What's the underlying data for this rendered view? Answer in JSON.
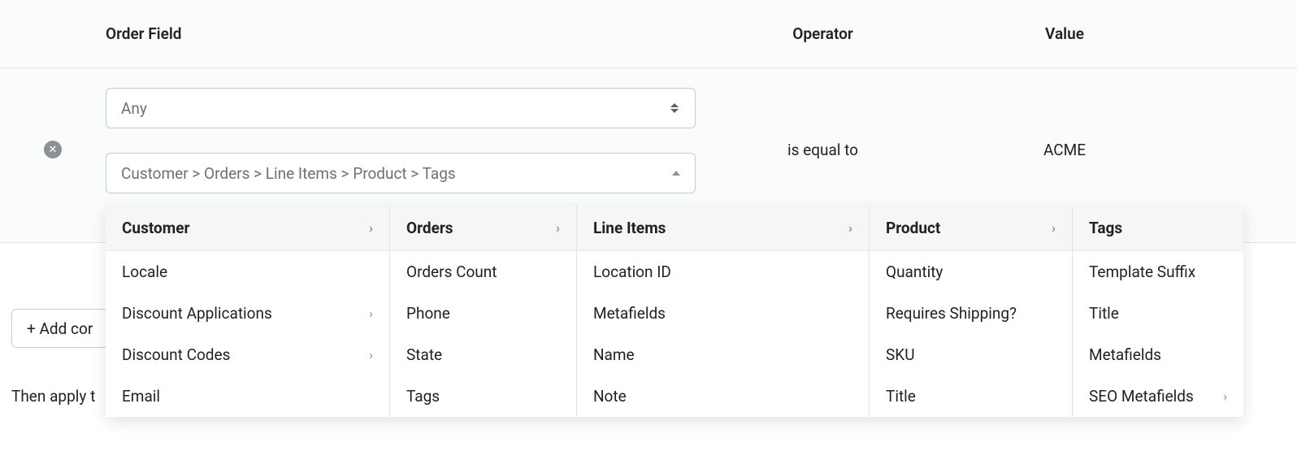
{
  "headers": {
    "field": "Order Field",
    "operator": "Operator",
    "value": "Value"
  },
  "condition": {
    "any_select": "Any",
    "breadcrumb": "Customer > Orders > Line Items > Product > Tags",
    "operator_text": "is equal to",
    "value_text": "ACME"
  },
  "add_condition_label": "+ Add cor",
  "then_apply_text": "Then apply t",
  "cascader": {
    "columns": [
      {
        "header": "Customer",
        "header_has_chevron": true,
        "items": [
          {
            "label": "Locale",
            "chevron": false
          },
          {
            "label": "Discount Applications",
            "chevron": true
          },
          {
            "label": "Discount Codes",
            "chevron": true
          },
          {
            "label": "Email",
            "chevron": false
          }
        ]
      },
      {
        "header": "Orders",
        "header_has_chevron": true,
        "items": [
          {
            "label": "Orders Count",
            "chevron": false
          },
          {
            "label": "Phone",
            "chevron": false
          },
          {
            "label": "State",
            "chevron": false
          },
          {
            "label": "Tags",
            "chevron": false
          }
        ]
      },
      {
        "header": "Line Items",
        "header_has_chevron": true,
        "items": [
          {
            "label": "Location ID",
            "chevron": false
          },
          {
            "label": "Metafields",
            "chevron": false
          },
          {
            "label": "Name",
            "chevron": false
          },
          {
            "label": "Note",
            "chevron": false
          }
        ]
      },
      {
        "header": "Product",
        "header_has_chevron": true,
        "items": [
          {
            "label": "Quantity",
            "chevron": false
          },
          {
            "label": "Requires Shipping?",
            "chevron": false
          },
          {
            "label": "SKU",
            "chevron": false
          },
          {
            "label": "Title",
            "chevron": false
          }
        ]
      },
      {
        "header": "Tags",
        "header_has_chevron": false,
        "items": [
          {
            "label": "Template Suffix",
            "chevron": false
          },
          {
            "label": "Title",
            "chevron": false
          },
          {
            "label": "Metafields",
            "chevron": false
          },
          {
            "label": "SEO Metafields",
            "chevron": true
          }
        ]
      }
    ]
  }
}
